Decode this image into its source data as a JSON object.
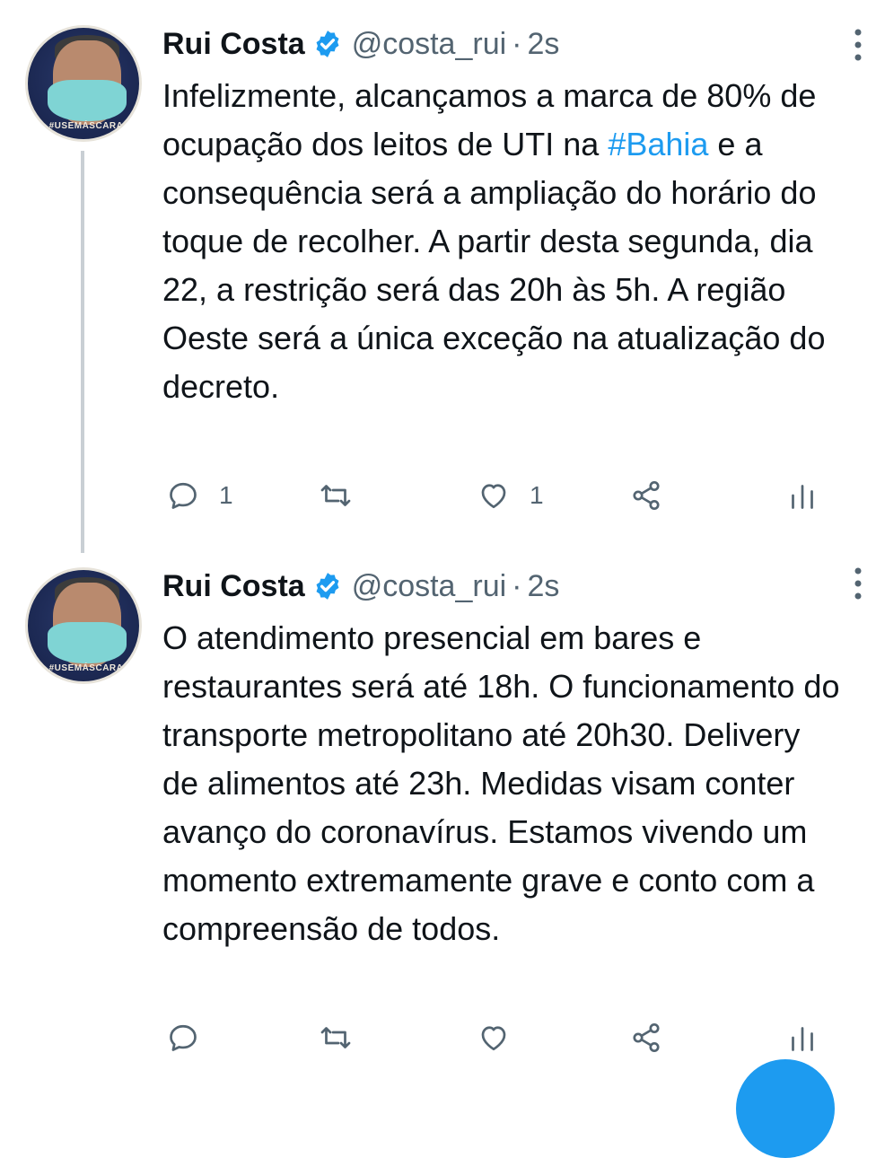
{
  "colors": {
    "accent": "#1d9bf0",
    "text_primary": "#0f1419",
    "text_secondary": "#536471",
    "thread_line": "#c9cfd4"
  },
  "tweets": [
    {
      "author": {
        "name": "Rui Costa",
        "handle": "@costa_rui",
        "verified": true,
        "avatar_badge": "#USEMÁSCARA"
      },
      "separator": "·",
      "time": "2s",
      "text_before_hashtag": "Infelizmente, alcançamos a marca de 80% de ocupação dos leitos de UTI na ",
      "hashtag": "#Bahia",
      "text_after_hashtag": " e a consequência será a ampliação do horário do toque de recolher. A partir desta segunda, dia 22, a restrição será das 20h às 5h. A região Oeste será a única exceção na atualização do decreto.",
      "reply_count": "1",
      "retweet_count": "",
      "like_count": "1",
      "icons": [
        "reply-icon",
        "retweet-icon",
        "like-icon",
        "share-icon",
        "analytics-icon",
        "more-vertical-icon",
        "verified-icon"
      ]
    },
    {
      "author": {
        "name": "Rui Costa",
        "handle": "@costa_rui",
        "verified": true,
        "avatar_badge": "#USEMÁSCARA"
      },
      "separator": "·",
      "time": "2s",
      "text": "O atendimento presencial em bares e restaurantes será até 18h. O funcionamento do transporte metropolitano até 20h30. Delivery de alimentos até 23h. Medidas visam conter avanço do coronavírus. Estamos vivendo um momento extremamente grave e conto com a compreensão de todos.",
      "reply_count": "",
      "retweet_count": "",
      "like_count": "",
      "icons": [
        "reply-icon",
        "retweet-icon",
        "like-icon",
        "share-icon",
        "analytics-icon",
        "more-vertical-icon",
        "verified-icon"
      ]
    }
  ]
}
